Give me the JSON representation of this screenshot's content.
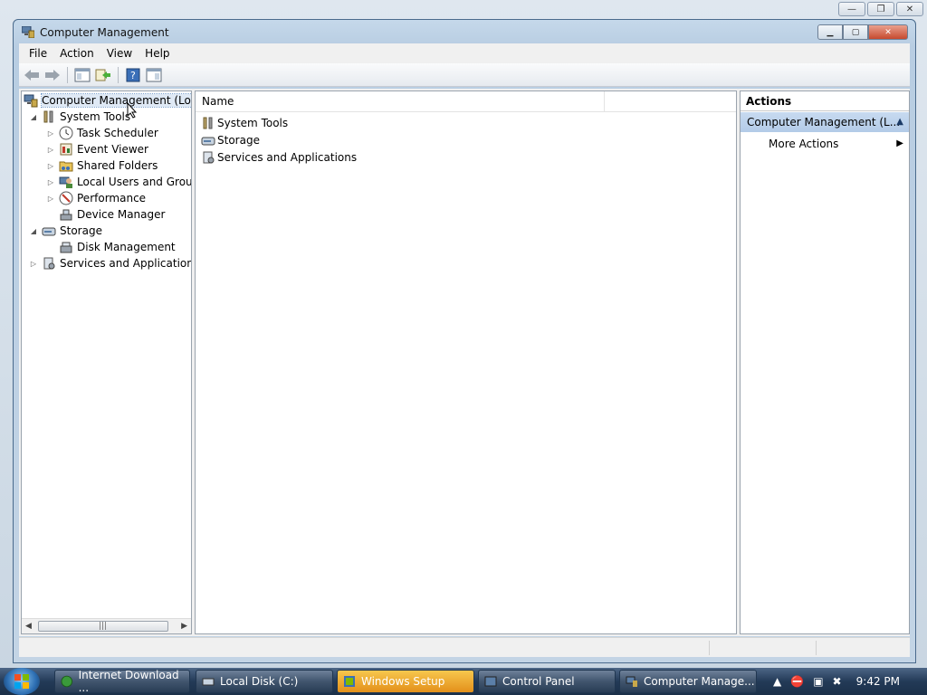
{
  "window": {
    "title": "Computer Management"
  },
  "menu": [
    "File",
    "Action",
    "View",
    "Help"
  ],
  "tree": {
    "root": "Computer Management (Local",
    "items": [
      {
        "label": "System Tools",
        "level": 1,
        "expander": "◢"
      },
      {
        "label": "Task Scheduler",
        "level": 2,
        "expander": "▷"
      },
      {
        "label": "Event Viewer",
        "level": 2,
        "expander": "▷"
      },
      {
        "label": "Shared Folders",
        "level": 2,
        "expander": "▷"
      },
      {
        "label": "Local Users and Groups",
        "level": 2,
        "expander": "▷"
      },
      {
        "label": "Performance",
        "level": 2,
        "expander": "▷"
      },
      {
        "label": "Device Manager",
        "level": 2,
        "expander": ""
      },
      {
        "label": "Storage",
        "level": 1,
        "expander": "◢"
      },
      {
        "label": "Disk Management",
        "level": 2,
        "expander": ""
      },
      {
        "label": "Services and Applications",
        "level": 1,
        "expander": "▷"
      }
    ]
  },
  "list": {
    "column_name": "Name",
    "items": [
      "System Tools",
      "Storage",
      "Services and Applications"
    ]
  },
  "actions": {
    "header": "Actions",
    "section": "Computer Management (L...",
    "more": "More Actions"
  },
  "taskbar": {
    "tasks": [
      {
        "label": "Internet Download ...",
        "active": false
      },
      {
        "label": "Local Disk (C:)",
        "active": false
      },
      {
        "label": "Windows Setup",
        "active": true
      },
      {
        "label": "Control Panel",
        "active": false
      },
      {
        "label": "Computer Manage...",
        "active": false
      }
    ],
    "clock": "9:42 PM"
  }
}
